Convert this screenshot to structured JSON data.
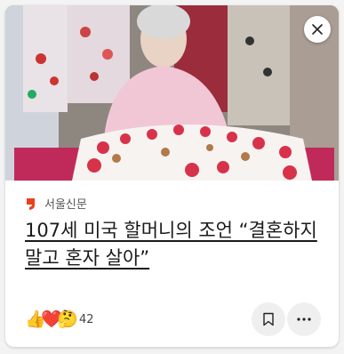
{
  "article": {
    "source_name": "서울신문",
    "headline": "107세 미국 할머니의 조언 “결혼하지 말고 혼자 살아”",
    "reaction_count": "42"
  },
  "icons": {
    "close": "close-icon",
    "bookmark": "bookmark-icon",
    "more": "more-options-icon",
    "reactions": [
      "thumbs-up-icon",
      "heart-icon",
      "thinking-face-icon"
    ]
  },
  "colors": {
    "source_logo": "#e8421c",
    "headline": "#1a1a1a"
  }
}
